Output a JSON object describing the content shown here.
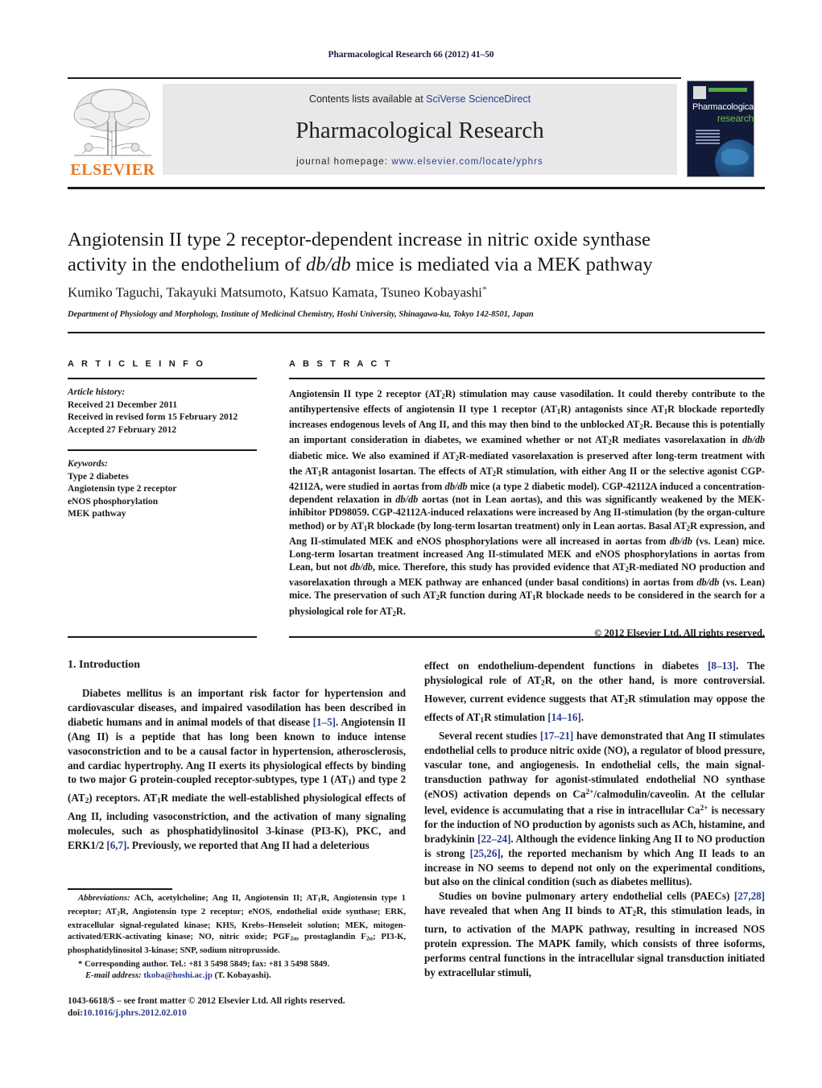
{
  "running_head": "Pharmacological Research 66 (2012) 41–50",
  "header": {
    "contents_prefix": "Contents lists available at ",
    "sciencedirect_link": "SciVerse ScienceDirect",
    "journal_name": "Pharmacological Research",
    "homepage_prefix": "journal homepage: ",
    "homepage_url": "www.elsevier.com/locate/yphrs",
    "publisher": "ELSEVIER",
    "cover": {
      "line1": "Pharmacological",
      "line2": "research"
    }
  },
  "article": {
    "title_line1": "Angiotensin II type 2 receptor-dependent increase in nitric oxide synthase",
    "title_line2_a": "activity in the endothelium of ",
    "title_line2_italic": "db/db",
    "title_line2_b": " mice is mediated via a MEK pathway",
    "authors": "Kumiko Taguchi, Takayuki Matsumoto, Katsuo Kamata, Tsuneo Kobayashi",
    "author_marker": "*",
    "affiliation": "Department of Physiology and Morphology, Institute of Medicinal Chemistry, Hoshi University, Shinagawa-ku, Tokyo 142-8501, Japan"
  },
  "article_info": {
    "heading": "A R T I C L E    I N F O",
    "history_label": "Article history:",
    "history": [
      "Received 21 December 2011",
      "Received in revised form 15 February 2012",
      "Accepted 27 February 2012"
    ],
    "keywords_label": "Keywords:",
    "keywords": [
      "Type 2 diabetes",
      "Angiotensin type 2 receptor",
      "eNOS phosphorylation",
      "MEK pathway"
    ]
  },
  "abstract": {
    "heading": "A B S T R A C T",
    "text": "Angiotensin II type 2 receptor (AT2R) stimulation may cause vasodilation. It could thereby contribute to the antihypertensive effects of angiotensin II type 1 receptor (AT1R) antagonists since AT1R blockade reportedly increases endogenous levels of Ang II, and this may then bind to the unblocked AT2R. Because this is potentially an important consideration in diabetes, we examined whether or not AT2R mediates vasorelaxation in db/db diabetic mice. We also examined if AT2R-mediated vasorelaxation is preserved after long-term treatment with the AT1R antagonist losartan. The effects of AT2R stimulation, with either Ang II or the selective agonist CGP-42112A, were studied in aortas from db/db mice (a type 2 diabetic model). CGP-42112A induced a concentration-dependent relaxation in db/db aortas (not in Lean aortas), and this was significantly weakened by the MEK-inhibitor PD98059. CGP-42112A-induced relaxations were increased by Ang II-stimulation (by the organ-culture method) or by AT1R blockade (by long-term losartan treatment) only in Lean aortas. Basal AT2R expression, and Ang II-stimulated MEK and eNOS phosphorylations were all increased in aortas from db/db (vs. Lean) mice. Long-term losartan treatment increased Ang II-stimulated MEK and eNOS phosphorylations in aortas from Lean, but not db/db, mice. Therefore, this study has provided evidence that AT2R-mediated NO production and vasorelaxation through a MEK pathway are enhanced (under basal conditions) in aortas from db/db (vs. Lean) mice. The preservation of such AT2R function during AT1R blockade needs to be considered in the search for a physiological role for AT2R.",
    "copyright": "© 2012 Elsevier Ltd. All rights reserved."
  },
  "introduction": {
    "heading": "1. Introduction",
    "para1": "Diabetes mellitus is an important risk factor for hypertension and cardiovascular diseases, and impaired vasodilation has been described in diabetic humans and in animal models of that disease [1–5]. Angiotensin II (Ang II) is a peptide that has long been known to induce intense vasoconstriction and to be a causal factor in hypertension, atherosclerosis, and cardiac hypertrophy. Ang II exerts its physiological effects by binding to two major G protein-coupled receptor-subtypes, type 1 (AT1) and type 2 (AT2) receptors. AT1R mediate the well-established physiological effects of Ang II, including vasoconstriction, and the activation of many signaling molecules, such as phosphatidylinositol 3-kinase (PI3-K), PKC, and ERK1/2 [6,7]. Previously, we reported that Ang II had a deleterious",
    "para1_cont": "effect on endothelium-dependent functions in diabetes [8–13]. The physiological role of AT2R, on the other hand, is more controversial. However, current evidence suggests that AT2R stimulation may oppose the effects of AT1R stimulation [14–16].",
    "para2": "Several recent studies [17–21] have demonstrated that Ang II stimulates endothelial cells to produce nitric oxide (NO), a regulator of blood pressure, vascular tone, and angiogenesis. In endothelial cells, the main signal-transduction pathway for agonist-stimulated endothelial NO synthase (eNOS) activation depends on Ca2+/calmodulin/caveolin. At the cellular level, evidence is accumulating that a rise in intracellular Ca2+ is necessary for the induction of NO production by agonists such as ACh, histamine, and bradykinin [22–24]. Although the evidence linking Ang II to NO production is strong [25,26], the reported mechanism by which Ang II leads to an increase in NO seems to depend not only on the experimental conditions, but also on the clinical condition (such as diabetes mellitus).",
    "para3": "Studies on bovine pulmonary artery endothelial cells (PAECs) [27,28] have revealed that when Ang II binds to AT2R, this stimulation leads, in turn, to activation of the MAPK pathway, resulting in increased NOS protein expression. The MAPK family, which consists of three isoforms, performs central functions in the intracellular signal transduction initiated by extracellular stimuli,"
  },
  "footnotes": {
    "abbreviations_label": "Abbreviations:",
    "abbreviations_text": "ACh, acetylcholine; Ang II, Angiotensin II; AT1R, Angiotensin type 1 receptor; AT2R, Angiotensin type 2 receptor; eNOS, endothelial oxide synthase; ERK, extracellular signal-regulated kinase; KHS, Krebs–Henseleit solution; MEK, mitogen-activated/ERK-activating kinase; NO, nitric oxide; PGF2α, prostaglandin F2α; PI3-K, phosphatidylinositol 3-kinase; SNP, sodium nitroprusside.",
    "corresponding": "* Corresponding author. Tel.: +81 3 5498 5849; fax: +81 3 5498 5849.",
    "email_label": "E-mail address:",
    "email": "tkoba@hoshi.ac.jp",
    "email_owner": "(T. Kobayashi)."
  },
  "imprint": {
    "line1": "1043-6618/$ – see front matter © 2012 Elsevier Ltd. All rights reserved.",
    "doi_label": "doi:",
    "doi_value": "10.1016/j.phrs.2012.02.010"
  },
  "colors": {
    "link": "#2d3c8f",
    "elsevier_orange": "#e87722",
    "band_grey": "#e8e8ea",
    "cover_navy": "#111a38",
    "cover_green": "#5aa83c"
  }
}
